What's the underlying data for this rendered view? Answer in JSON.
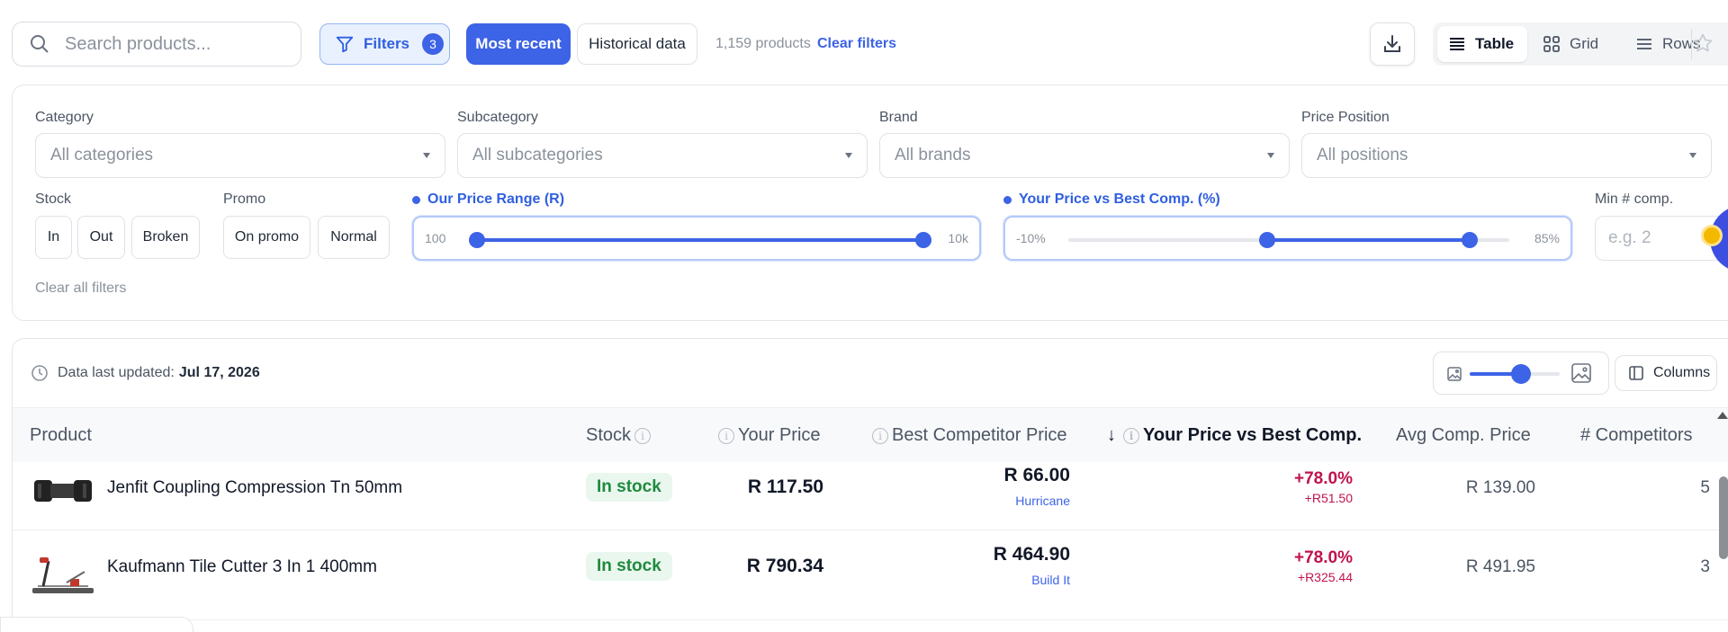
{
  "toolbar": {
    "search_placeholder": "Search products...",
    "filters_label": "Filters",
    "filters_count": "3",
    "most_recent_label": "Most recent",
    "historical_label": "Historical data",
    "product_count": "1,159 products",
    "clear_filters": "Clear filters",
    "views": [
      {
        "label": "Table",
        "icon": "table-icon",
        "active": true
      },
      {
        "label": "Grid",
        "icon": "grid-icon",
        "active": false
      },
      {
        "label": "Rows",
        "icon": "rows-icon",
        "active": false
      }
    ]
  },
  "filters": {
    "category": {
      "label": "Category",
      "value": "All categories"
    },
    "subcategory": {
      "label": "Subcategory",
      "value": "All subcategories"
    },
    "brand": {
      "label": "Brand",
      "value": "All brands"
    },
    "price_position": {
      "label": "Price Position",
      "value": "All positions"
    },
    "stock": {
      "label": "Stock",
      "options": [
        "In",
        "Out",
        "Broken"
      ]
    },
    "promo": {
      "label": "Promo",
      "options": [
        "On promo",
        "Normal"
      ]
    },
    "price_range": {
      "label": "Our Price Range (R)",
      "min_label": "100",
      "max_label": "10k",
      "low_fraction": 0.0,
      "high_fraction": 1.0
    },
    "vs_best": {
      "label": "Your Price vs Best Comp. (%)",
      "min_label": "-10%",
      "max_label": "85%",
      "low_fraction": 0.45,
      "high_fraction": 0.91
    },
    "min_comp": {
      "label": "Min # comp.",
      "placeholder": "e.g. 2"
    },
    "clear_all": "Clear all filters"
  },
  "table_header": {
    "updated_prefix": "Data last updated:",
    "updated_date": "Jul 17, 2026",
    "columns_button": "Columns",
    "image_zoom_fraction": 0.5,
    "columns": {
      "product": "Product",
      "stock": "Stock",
      "your_price": "Your Price",
      "best_comp": "Best Competitor Price",
      "sort_arrow": "↓",
      "vs_best": "Your Price vs Best Comp.",
      "avg_comp": "Avg Comp. Price",
      "n_comp": "# Competitors"
    }
  },
  "rows": [
    {
      "name": "Jenfit Coupling Compression Tn 50mm",
      "stock": "In stock",
      "your_price": "R 117.50",
      "best_price": "R 66.00",
      "best_store": "Hurricane",
      "vs_pct": "+78.0%",
      "vs_abs": "+R51.50",
      "avg_price": "R 139.00",
      "competitors": "5"
    },
    {
      "name": "Kaufmann Tile Cutter 3 In 1 400mm",
      "stock": "In stock",
      "your_price": "R 790.34",
      "best_price": "R 464.90",
      "best_store": "Build It",
      "vs_pct": "+78.0%",
      "vs_abs": "+R325.44",
      "avg_price": "R 491.95",
      "competitors": "3"
    }
  ],
  "colors": {
    "accent": "#3d63e6",
    "positive_diff": "#c0134c",
    "in_stock_bg": "#eaf7ee",
    "in_stock_text": "#1f8a3e"
  }
}
